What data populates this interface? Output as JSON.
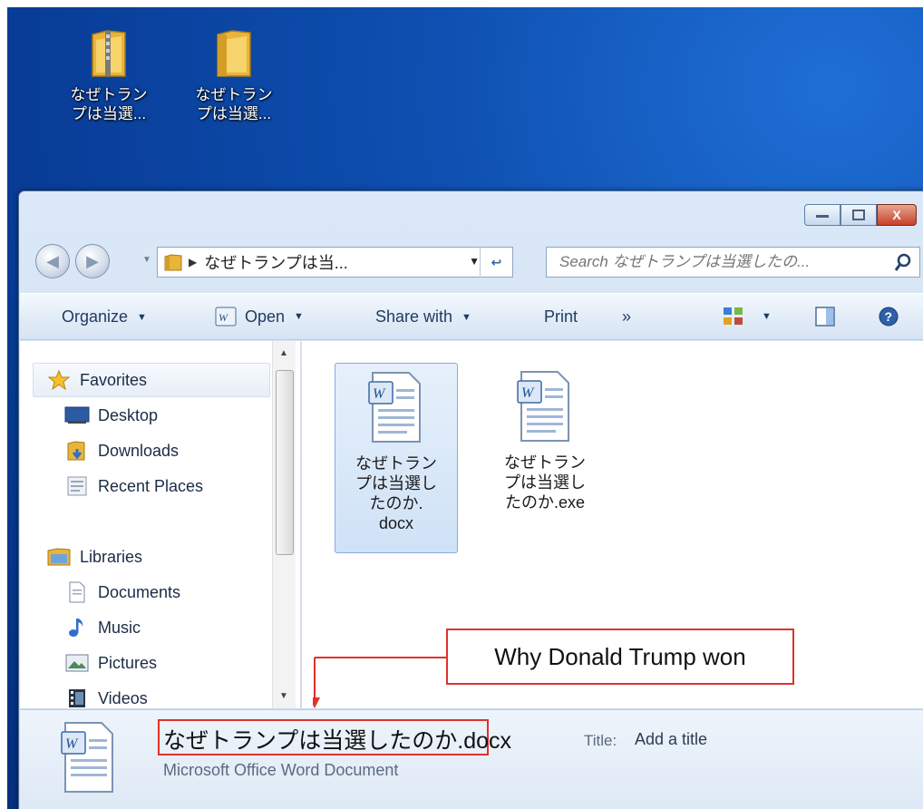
{
  "desktop": {
    "icons": [
      {
        "label_line1": "なぜトラン",
        "label_line2": "プは当選...",
        "icon": "zip-folder-icon"
      },
      {
        "label_line1": "なぜトラン",
        "label_line2": "プは当選...",
        "icon": "folder-icon"
      }
    ]
  },
  "window": {
    "caption_buttons": {
      "minimize": "–",
      "maximize": "□",
      "close": "X"
    },
    "address": {
      "path": "なぜトランプは当..."
    },
    "search": {
      "placeholder": "Search なぜトランプは当選したの..."
    },
    "toolbar": {
      "organize": "Organize",
      "open": "Open",
      "share_with": "Share with",
      "print": "Print",
      "more": "»"
    },
    "nav": {
      "favorites": "Favorites",
      "desktop": "Desktop",
      "downloads": "Downloads",
      "recent_places": "Recent Places",
      "libraries": "Libraries",
      "documents": "Documents",
      "music": "Music",
      "pictures": "Pictures",
      "videos": "Videos"
    },
    "files": [
      {
        "line1": "なぜトラン",
        "line2": "プは当選し",
        "line3": "たのか.",
        "line4": "docx"
      },
      {
        "line1": "なぜトラン",
        "line2": "プは当選し",
        "line3": "たのか.exe"
      }
    ],
    "details": {
      "name": "なぜトランプは当選したのか.docx",
      "type": "Microsoft Office Word Document",
      "title_label": "Title:",
      "title_value": "Add a title"
    }
  },
  "annotation": {
    "callout": "Why Donald Trump won",
    "color": "#e0322a"
  }
}
